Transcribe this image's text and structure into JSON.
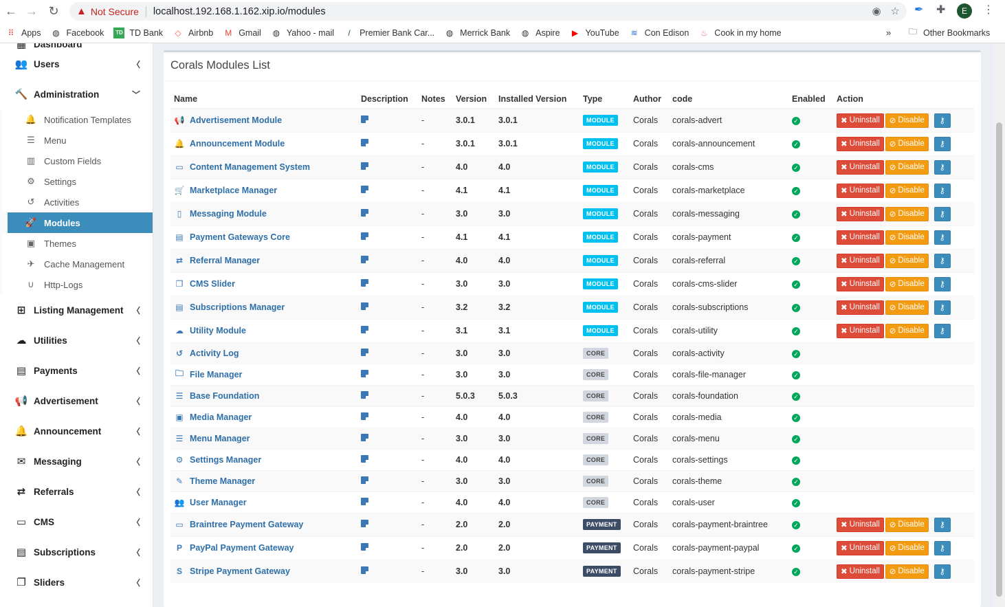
{
  "browser": {
    "security": "Not Secure",
    "url": "localhost.192.168.1.162.xip.io/modules",
    "avatar_letter": "E"
  },
  "bookmarks": [
    {
      "label": "Apps",
      "icon": "apps-grid-icon",
      "color": "#ea4335"
    },
    {
      "label": "Facebook",
      "icon": "globe-icon",
      "color": "#333333"
    },
    {
      "label": "TD Bank",
      "icon": "td-logo-icon",
      "color": "#34a853"
    },
    {
      "label": "Airbnb",
      "icon": "airbnb-icon",
      "color": "#ff5a5f"
    },
    {
      "label": "Gmail",
      "icon": "gmail-icon",
      "color": "#ea4335"
    },
    {
      "label": "Yahoo - mail",
      "icon": "globe-icon",
      "color": "#333333"
    },
    {
      "label": "Premier Bank Car...",
      "icon": "premier-icon",
      "color": "#1a5e20"
    },
    {
      "label": "Merrick Bank",
      "icon": "globe-icon",
      "color": "#333333"
    },
    {
      "label": "Aspire",
      "icon": "globe-icon",
      "color": "#333333"
    },
    {
      "label": "YouTube",
      "icon": "youtube-icon",
      "color": "#ff0000"
    },
    {
      "label": "Con Edison",
      "icon": "conedison-icon",
      "color": "#1a73e8"
    },
    {
      "label": "Cook in my home",
      "icon": "cook-icon",
      "color": "#e57373"
    }
  ],
  "bookmarks_overflow": "»",
  "other_bookmarks": "Other Bookmarks",
  "sidebar": {
    "top_partial": "Dashboard",
    "items_before": [
      {
        "label": "Users",
        "icon": "users-icon",
        "glyph": "👥"
      },
      {
        "label": "Administration",
        "icon": "gavel-icon",
        "glyph": "🔨"
      }
    ],
    "admin_sub": [
      {
        "label": "Notification Templates",
        "icon": "bell-icon",
        "glyph": "🔔"
      },
      {
        "label": "Menu",
        "icon": "bars-icon",
        "glyph": "☰"
      },
      {
        "label": "Custom Fields",
        "icon": "columns-icon",
        "glyph": "▥"
      },
      {
        "label": "Settings",
        "icon": "cogs-icon",
        "glyph": "⚙"
      },
      {
        "label": "Activities",
        "icon": "history-icon",
        "glyph": "↺"
      },
      {
        "label": "Modules",
        "icon": "rocket-icon",
        "glyph": "🚀",
        "active": true
      },
      {
        "label": "Themes",
        "icon": "image-icon",
        "glyph": "▣"
      },
      {
        "label": "Cache Management",
        "icon": "plane-icon",
        "glyph": "✈"
      },
      {
        "label": "Http-Logs",
        "icon": "magnet-icon",
        "glyph": "∪"
      }
    ],
    "items_after": [
      {
        "label": "Listing Management",
        "icon": "sitemap-icon",
        "glyph": "⊞"
      },
      {
        "label": "Utilities",
        "icon": "cloud-icon",
        "glyph": "☁"
      },
      {
        "label": "Payments",
        "icon": "money-icon",
        "glyph": "▤"
      },
      {
        "label": "Advertisement",
        "icon": "bullhorn-icon",
        "glyph": "📢"
      },
      {
        "label": "Announcement",
        "icon": "bell-icon",
        "glyph": "🔔"
      },
      {
        "label": "Messaging",
        "icon": "envelope-icon",
        "glyph": "✉"
      },
      {
        "label": "Referrals",
        "icon": "retweet-icon",
        "glyph": "⇄"
      },
      {
        "label": "CMS",
        "icon": "desktop-icon",
        "glyph": "▭"
      },
      {
        "label": "Subscriptions",
        "icon": "list-alt-icon",
        "glyph": "▤"
      },
      {
        "label": "Sliders",
        "icon": "clone-icon",
        "glyph": "❐"
      }
    ]
  },
  "main": {
    "title": "Corals Modules List",
    "columns": [
      "Name",
      "Description",
      "Notes",
      "Version",
      "Installed Version",
      "Type",
      "Author",
      "code",
      "Enabled",
      "Action"
    ],
    "actions": {
      "uninstall": "Uninstall",
      "disable": "Disable"
    },
    "rows": [
      {
        "name": "Advertisement Module",
        "icon": "bullhorn-icon",
        "glyph": "📢",
        "notes": "-",
        "version": "3.0.1",
        "installed": "3.0.1",
        "type": "MODULE",
        "author": "Corals",
        "code": "corals-advert",
        "actions": true
      },
      {
        "name": "Announcement Module",
        "icon": "bell-icon",
        "glyph": "🔔",
        "notes": "-",
        "version": "3.0.1",
        "installed": "3.0.1",
        "type": "MODULE",
        "author": "Corals",
        "code": "corals-announcement",
        "actions": true
      },
      {
        "name": "Content Management System",
        "icon": "desktop-icon",
        "glyph": "▭",
        "notes": "-",
        "version": "4.0",
        "installed": "4.0",
        "type": "MODULE",
        "author": "Corals",
        "code": "corals-cms",
        "actions": true
      },
      {
        "name": "Marketplace Manager",
        "icon": "cart-icon",
        "glyph": "🛒",
        "notes": "-",
        "version": "4.1",
        "installed": "4.1",
        "type": "MODULE",
        "author": "Corals",
        "code": "corals-marketplace",
        "actions": true
      },
      {
        "name": "Messaging Module",
        "icon": "mobile-icon",
        "glyph": "▯",
        "notes": "-",
        "version": "3.0",
        "installed": "3.0",
        "type": "MODULE",
        "author": "Corals",
        "code": "corals-messaging",
        "actions": true
      },
      {
        "name": "Payment Gateways Core",
        "icon": "money-icon",
        "glyph": "▤",
        "notes": "-",
        "version": "4.1",
        "installed": "4.1",
        "type": "MODULE",
        "author": "Corals",
        "code": "corals-payment",
        "actions": true
      },
      {
        "name": "Referral Manager",
        "icon": "retweet-icon",
        "glyph": "⇄",
        "notes": "-",
        "version": "4.0",
        "installed": "4.0",
        "type": "MODULE",
        "author": "Corals",
        "code": "corals-referral",
        "actions": true
      },
      {
        "name": "CMS Slider",
        "icon": "clone-icon",
        "glyph": "❐",
        "notes": "-",
        "version": "3.0",
        "installed": "3.0",
        "type": "MODULE",
        "author": "Corals",
        "code": "corals-cms-slider",
        "actions": true
      },
      {
        "name": "Subscriptions Manager",
        "icon": "list-alt-icon",
        "glyph": "▤",
        "notes": "-",
        "version": "3.2",
        "installed": "3.2",
        "type": "MODULE",
        "author": "Corals",
        "code": "corals-subscriptions",
        "actions": true
      },
      {
        "name": "Utility Module",
        "icon": "cloud-icon",
        "glyph": "☁",
        "notes": "-",
        "version": "3.1",
        "installed": "3.1",
        "type": "MODULE",
        "author": "Corals",
        "code": "corals-utility",
        "actions": true
      },
      {
        "name": "Activity Log",
        "icon": "history-icon",
        "glyph": "↺",
        "notes": "-",
        "version": "3.0",
        "installed": "3.0",
        "type": "CORE",
        "author": "Corals",
        "code": "corals-activity",
        "actions": false
      },
      {
        "name": "File Manager",
        "icon": "folder-icon",
        "glyph": "🗀",
        "notes": "-",
        "version": "3.0",
        "installed": "3.0",
        "type": "CORE",
        "author": "Corals",
        "code": "corals-file-manager",
        "actions": false
      },
      {
        "name": "Base Foundation",
        "icon": "bars-icon",
        "glyph": "☰",
        "notes": "-",
        "version": "5.0.3",
        "installed": "5.0.3",
        "type": "CORE",
        "author": "Corals",
        "code": "corals-foundation",
        "actions": false
      },
      {
        "name": "Media Manager",
        "icon": "image-icon",
        "glyph": "▣",
        "notes": "-",
        "version": "4.0",
        "installed": "4.0",
        "type": "CORE",
        "author": "Corals",
        "code": "corals-media",
        "actions": false
      },
      {
        "name": "Menu Manager",
        "icon": "bars-icon",
        "glyph": "☰",
        "notes": "-",
        "version": "3.0",
        "installed": "3.0",
        "type": "CORE",
        "author": "Corals",
        "code": "corals-menu",
        "actions": false
      },
      {
        "name": "Settings Manager",
        "icon": "cogs-icon",
        "glyph": "⚙",
        "notes": "-",
        "version": "4.0",
        "installed": "4.0",
        "type": "CORE",
        "author": "Corals",
        "code": "corals-settings",
        "actions": false
      },
      {
        "name": "Theme Manager",
        "icon": "magic-icon",
        "glyph": "✎",
        "notes": "-",
        "version": "3.0",
        "installed": "3.0",
        "type": "CORE",
        "author": "Corals",
        "code": "corals-theme",
        "actions": false
      },
      {
        "name": "User Manager",
        "icon": "users-icon",
        "glyph": "👥",
        "notes": "-",
        "version": "4.0",
        "installed": "4.0",
        "type": "CORE",
        "author": "Corals",
        "code": "corals-user",
        "actions": false
      },
      {
        "name": "Braintree Payment Gateway",
        "icon": "credit-card-icon",
        "glyph": "▭",
        "notes": "-",
        "version": "2.0",
        "installed": "2.0",
        "type": "PAYMENT",
        "author": "Corals",
        "code": "corals-payment-braintree",
        "actions": true
      },
      {
        "name": "PayPal Payment Gateway",
        "icon": "paypal-icon",
        "glyph": "P",
        "notes": "-",
        "version": "2.0",
        "installed": "2.0",
        "type": "PAYMENT",
        "author": "Corals",
        "code": "corals-payment-paypal",
        "actions": true
      },
      {
        "name": "Stripe Payment Gateway",
        "icon": "stripe-icon",
        "glyph": "S",
        "notes": "-",
        "version": "3.0",
        "installed": "3.0",
        "type": "PAYMENT",
        "author": "Corals",
        "code": "corals-payment-stripe",
        "actions": true
      }
    ]
  }
}
